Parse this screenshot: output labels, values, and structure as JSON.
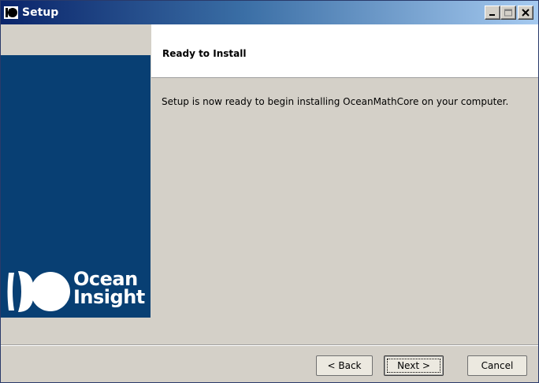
{
  "window": {
    "title": "Setup",
    "controls": {
      "minimize": "minimize-icon",
      "maximize": "maximize-icon",
      "close": "close-icon"
    }
  },
  "sidebar": {
    "logo_line1": "Ocean",
    "logo_line2": "Insight",
    "background_color": "#083f73"
  },
  "header": {
    "title": "Ready to Install"
  },
  "main": {
    "message": "Setup is now ready to begin installing OceanMathCore on your computer."
  },
  "buttons": {
    "back": "< Back",
    "next": "Next >",
    "cancel": "Cancel"
  }
}
